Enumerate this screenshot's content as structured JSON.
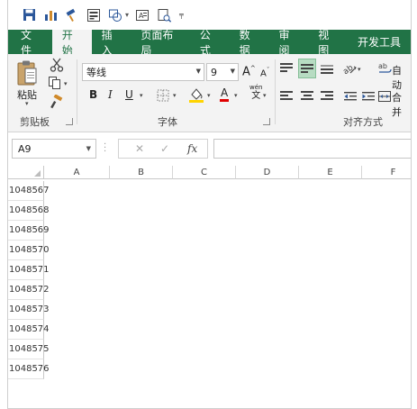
{
  "qat": {
    "icons": [
      "save-icon",
      "chart-icon",
      "format-painter-icon",
      "form-icon",
      "shape-icon",
      "textbox-icon",
      "preview-icon",
      "customize-icon"
    ]
  },
  "tabs": [
    {
      "label": "文件",
      "active": false
    },
    {
      "label": "开始",
      "active": true
    },
    {
      "label": "插入",
      "active": false
    },
    {
      "label": "页面布局",
      "active": false
    },
    {
      "label": "公式",
      "active": false
    },
    {
      "label": "数据",
      "active": false
    },
    {
      "label": "审阅",
      "active": false
    },
    {
      "label": "视图",
      "active": false
    },
    {
      "label": "开发工具",
      "active": false
    }
  ],
  "ribbon": {
    "clipboard": {
      "paste_label": "粘贴",
      "group_label": "剪贴板"
    },
    "font": {
      "font_name": "等线",
      "font_size": "9",
      "group_label": "字体",
      "bold": "B",
      "italic": "I",
      "underline": "U",
      "grow": "A",
      "shrink": "A",
      "font_color": "A",
      "phonetic_top": "wén",
      "phonetic_bottom": "文"
    },
    "alignment": {
      "group_label": "对齐方式",
      "wrap_label": "自动",
      "merge_label": "合并"
    }
  },
  "formula_bar": {
    "name_box": "A9",
    "fx_label": "fx",
    "cancel": "✕",
    "confirm": "✓",
    "formula": ""
  },
  "columns": [
    "A",
    "B",
    "C",
    "D",
    "E",
    "F"
  ],
  "rows": [
    "1048567",
    "1048568",
    "1048569",
    "1048570",
    "1048571",
    "1048572",
    "1048573",
    "1048574",
    "1048575",
    "1048576"
  ],
  "colors": {
    "accent": "#217346",
    "ribbon_bg": "#f3f3f3",
    "highlight": "#b7dcc2"
  }
}
